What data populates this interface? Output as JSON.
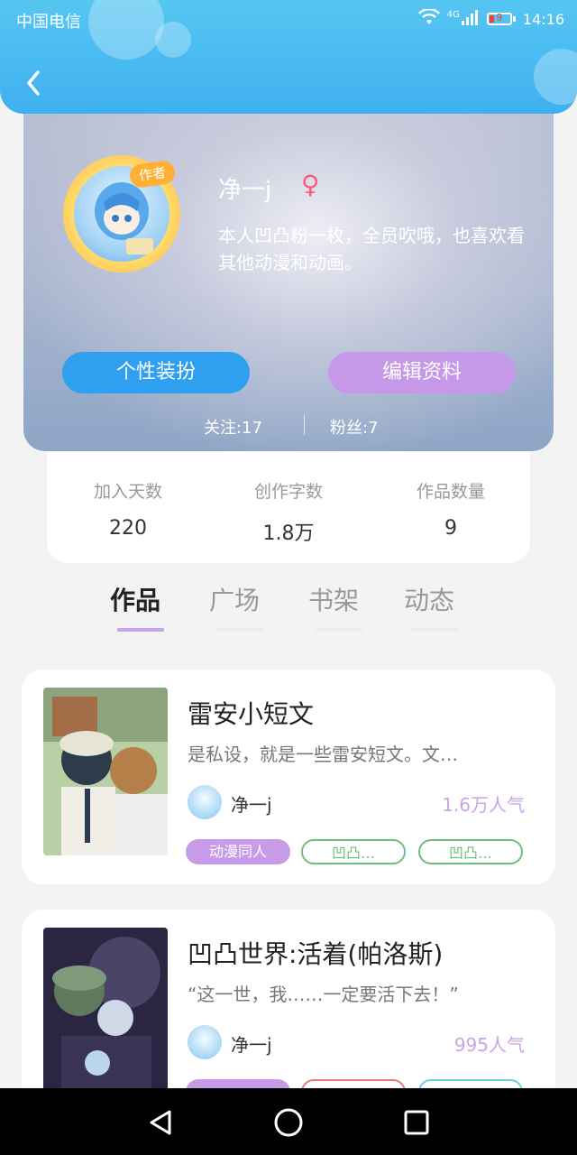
{
  "status_bar": {
    "carrier": "中国电信",
    "network": "4G",
    "battery_level": "9",
    "time": "14:16"
  },
  "profile": {
    "username": "净一j",
    "gender_symbol": "♀",
    "author_badge": "作者",
    "bio": "本人凹凸粉一枚，全员吹哦，也喜欢看其他动漫和动画。",
    "buttons": {
      "dress_up": "个性装扮",
      "edit_profile": "编辑资料"
    },
    "following": "关注:17",
    "followers": "粉丝:7"
  },
  "stats": [
    {
      "label": "加入天数",
      "value": "220"
    },
    {
      "label": "创作字数",
      "value": "1.8万"
    },
    {
      "label": "作品数量",
      "value": "9"
    }
  ],
  "tabs": [
    {
      "label": "作品",
      "active": true
    },
    {
      "label": "广场",
      "active": false
    },
    {
      "label": "书架",
      "active": false
    },
    {
      "label": "动态",
      "active": false
    }
  ],
  "works": [
    {
      "title": "雷安小短文",
      "description": "是私设，就是一些雷安短文。文…",
      "author": "净一j",
      "popularity": "1.6万人气",
      "tags": [
        "动漫同人",
        "凹凸…",
        "凹凸…"
      ]
    },
    {
      "title": "凹凸世界:活着(帕洛斯)",
      "description": "“这一世，我……一定要活下去！”",
      "author": "净一j",
      "popularity": "995人气",
      "tags": [
        "",
        "",
        ""
      ]
    }
  ],
  "icons": {
    "back": "chevron-left-icon",
    "wifi": "wifi-icon",
    "signal": "signal-icon",
    "battery": "battery-icon",
    "nav_back": "triangle-back-icon",
    "nav_home": "circle-home-icon",
    "nav_recent": "square-recent-icon"
  },
  "colors": {
    "header": "#3eb0f0",
    "accent_blue": "#2f9ff0",
    "accent_purple": "#c598e8",
    "popularity": "#c8a5e6"
  }
}
